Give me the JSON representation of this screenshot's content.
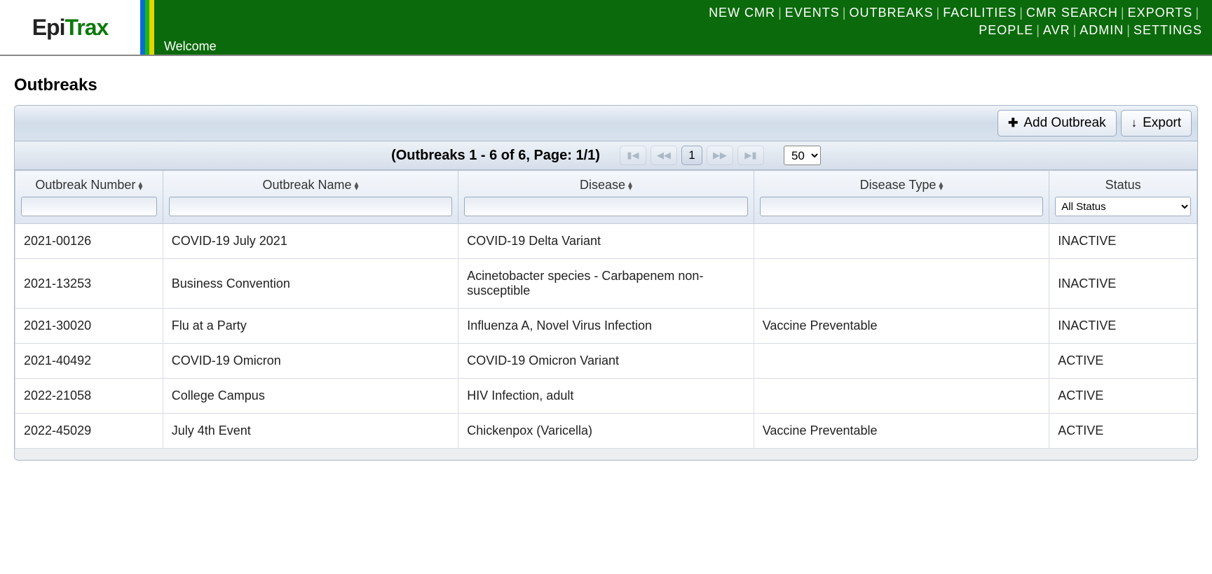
{
  "logo": {
    "part1": "Epi",
    "part2": "Trax"
  },
  "nav": {
    "row1": [
      "NEW CMR",
      "EVENTS",
      "OUTBREAKS",
      "FACILITIES",
      "CMR SEARCH",
      "EXPORTS"
    ],
    "row2": [
      "PEOPLE",
      "AVR",
      "ADMIN",
      "SETTINGS"
    ]
  },
  "welcome": "Welcome",
  "page_title": "Outbreaks",
  "toolbar": {
    "add_label": "Add Outbreak",
    "export_label": "Export"
  },
  "pager": {
    "info": "(Outbreaks 1 - 6 of 6, Page: 1/1)",
    "current_page": "1",
    "page_size": "50"
  },
  "columns": {
    "number": "Outbreak Number",
    "name": "Outbreak Name",
    "disease": "Disease",
    "disease_type": "Disease Type",
    "status": "Status"
  },
  "status_filter": {
    "selected": "All Status"
  },
  "rows": [
    {
      "number": "2021-00126",
      "name": "COVID-19 July 2021",
      "disease": "COVID-19 Delta Variant",
      "disease_type": "",
      "status": "INACTIVE"
    },
    {
      "number": "2021-13253",
      "name": "Business Convention",
      "disease": "Acinetobacter species - Carbapenem non-susceptible",
      "disease_type": "",
      "status": "INACTIVE"
    },
    {
      "number": "2021-30020",
      "name": "Flu at a Party",
      "disease": "Influenza A, Novel Virus Infection",
      "disease_type": "Vaccine Preventable",
      "status": "INACTIVE"
    },
    {
      "number": "2021-40492",
      "name": "COVID-19 Omicron",
      "disease": "COVID-19 Omicron Variant",
      "disease_type": "",
      "status": "ACTIVE"
    },
    {
      "number": "2022-21058",
      "name": "College Campus",
      "disease": "HIV Infection, adult",
      "disease_type": "",
      "status": "ACTIVE"
    },
    {
      "number": "2022-45029",
      "name": "July 4th Event",
      "disease": "Chickenpox (Varicella)",
      "disease_type": "Vaccine Preventable",
      "status": "ACTIVE"
    }
  ]
}
